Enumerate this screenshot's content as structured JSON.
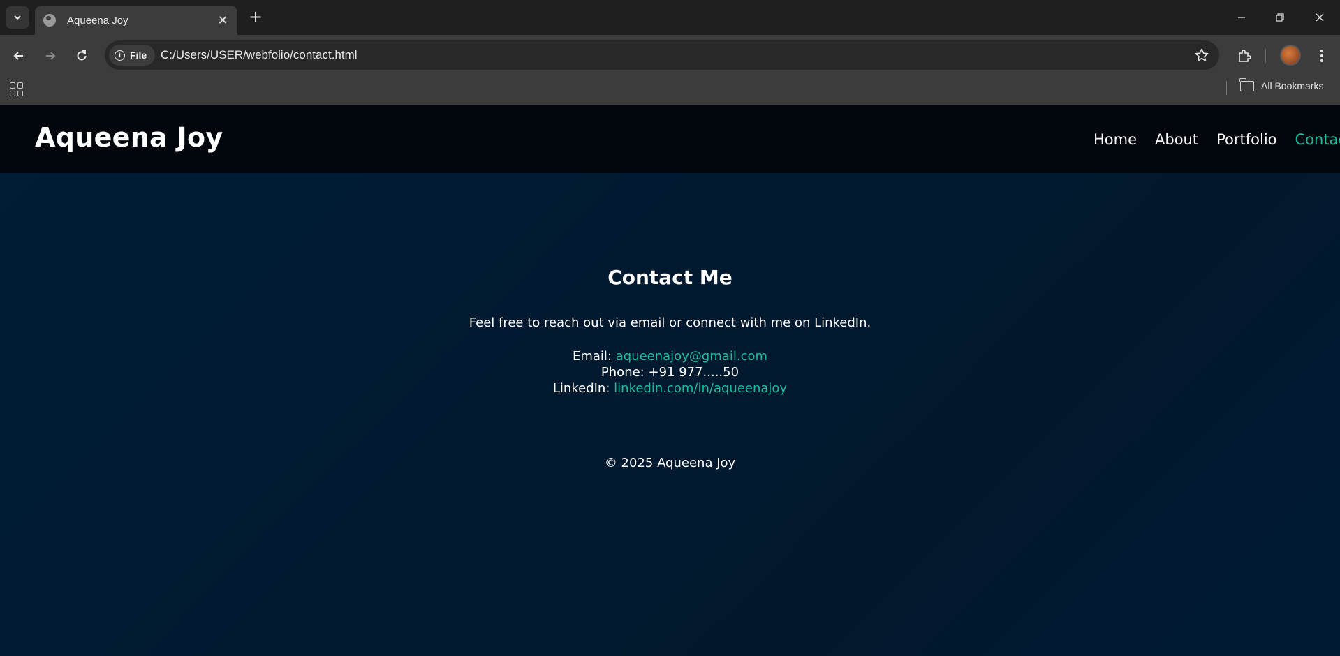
{
  "browser": {
    "tab_title": "Aqueena Joy",
    "chip_label": "File",
    "url": "C:/Users/USER/webfolio/contact.html",
    "all_bookmarks_label": "All Bookmarks"
  },
  "site": {
    "logo": "Aqueena Joy",
    "nav": [
      {
        "label": "Home",
        "active": false
      },
      {
        "label": "About",
        "active": false
      },
      {
        "label": "Portfolio",
        "active": false
      },
      {
        "label": "Contact",
        "active": true
      }
    ],
    "accent_color": "#1abc9c"
  },
  "contact": {
    "heading": "Contact Me",
    "intro": "Feel free to reach out via email or connect with me on LinkedIn.",
    "email_label": "Email:",
    "email_value": "aqueenajoy@gmail.com",
    "phone_label": "Phone:",
    "phone_value": "+91 977.....50",
    "linkedin_label": "LinkedIn:",
    "linkedin_value": "linkedin.com/in/aqueenajoy"
  },
  "footer": {
    "text": "© 2025 Aqueena Joy"
  }
}
